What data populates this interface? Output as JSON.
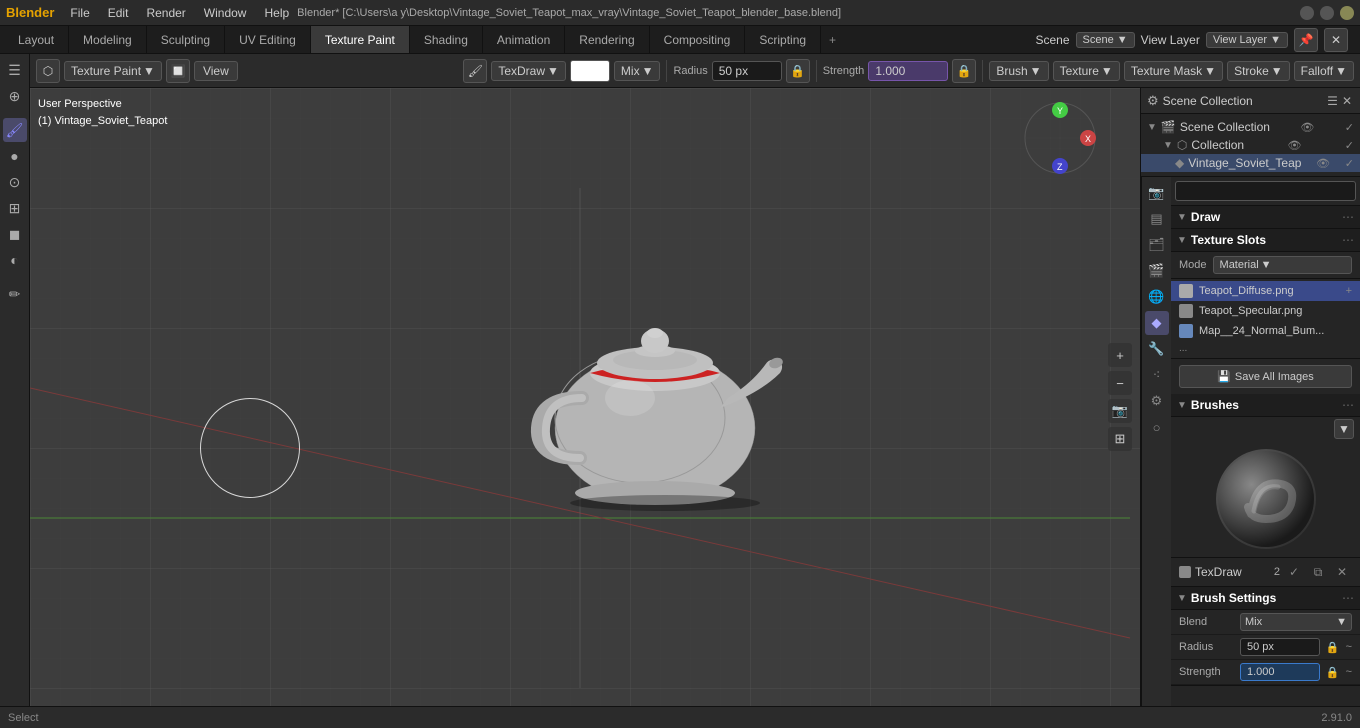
{
  "window": {
    "title": "Blender* [C:\\Users\\a y\\Desktop\\Vintage_Soviet_Teapot_max_vray\\Vintage_Soviet_Teapot_blender_base.blend]",
    "minimize": "—",
    "maximize": "□",
    "close": "✕"
  },
  "menu": {
    "items": [
      "Blender",
      "File",
      "Edit",
      "Render",
      "Window",
      "Help"
    ]
  },
  "workspace_tabs": {
    "tabs": [
      "Layout",
      "Modeling",
      "Sculpting",
      "UV Editing",
      "Texture Paint",
      "Shading",
      "Animation",
      "Rendering",
      "Compositing",
      "Scripting"
    ],
    "active": "Texture Paint",
    "add_label": "+",
    "scene_label": "Scene",
    "view_layer_label": "View Layer"
  },
  "top_toolbar": {
    "brush_type": "TexDraw",
    "color_swatch": "#ffffff",
    "blend_mode": "Mix",
    "radius_label": "Radius",
    "radius_value": "50 px",
    "strength_label": "Strength",
    "strength_value": "1.000",
    "brush_label": "Brush",
    "texture_label": "Texture",
    "texture_mask_label": "Texture Mask",
    "stroke_label": "Stroke",
    "falloff_label": "Falloff"
  },
  "secondary_toolbar": {
    "paint_label": "Texture Paint",
    "view_label": "View"
  },
  "viewport": {
    "perspective_label": "User Perspective",
    "object_label": "(1) Vintage_Soviet_Teapot",
    "brush_circle_size": 100
  },
  "right_panel": {
    "scene_collection_label": "Scene Collection",
    "collection_label": "Collection",
    "object_label": "Vintage_Soviet_Teap",
    "search_placeholder": "",
    "draw_label": "Draw",
    "texture_slots_label": "Texture Slots",
    "mode_label": "Mode",
    "mode_value": "Material",
    "textures": [
      {
        "name": "Teapot_Diffuse.png",
        "type": "diffuse",
        "selected": true
      },
      {
        "name": "Teapot_Specular.png",
        "type": "specular",
        "selected": false
      },
      {
        "name": "Map__24_Normal_Bum...",
        "type": "normal",
        "selected": false
      },
      {
        "name": "...",
        "type": "more",
        "selected": false
      }
    ],
    "save_all_label": "Save All Images",
    "brushes_label": "Brushes",
    "brush_name": "TexDraw",
    "brush_num": "2",
    "brush_settings_label": "Brush Settings",
    "blend_label": "Blend",
    "blend_value": "Mix",
    "radius_label": "Radius",
    "radius_value": "50 px",
    "strength_label": "Strength",
    "strength_value": "1.000"
  },
  "status_bar": {
    "left": "Select",
    "right": "2.91.0"
  },
  "icons": {
    "expand_right": "▶",
    "expand_down": "▼",
    "eye": "👁",
    "brush": "🖌",
    "paint_bucket": "🪣",
    "eraser": "⊘",
    "gradient": "◐",
    "line": "╱",
    "clone": "⊞",
    "dots": "⋯",
    "plus": "+",
    "check": "✓",
    "copy": "⧉",
    "delete": "✕",
    "camera": "🎥",
    "cube": "⬡",
    "mesh": "⬢",
    "material": "○",
    "modifier": "🔧",
    "object": "◆",
    "scene": "🎬",
    "world": "🌐",
    "render": "📷",
    "output": "▤",
    "view_layer": "🗂",
    "particles": "⁖",
    "physics": "⚙",
    "chevron": "⌄",
    "left_arrow": "‹",
    "right_arrow": "›",
    "pen_icon": "✏",
    "lock_icon": "🔒",
    "filter": "⋮"
  }
}
